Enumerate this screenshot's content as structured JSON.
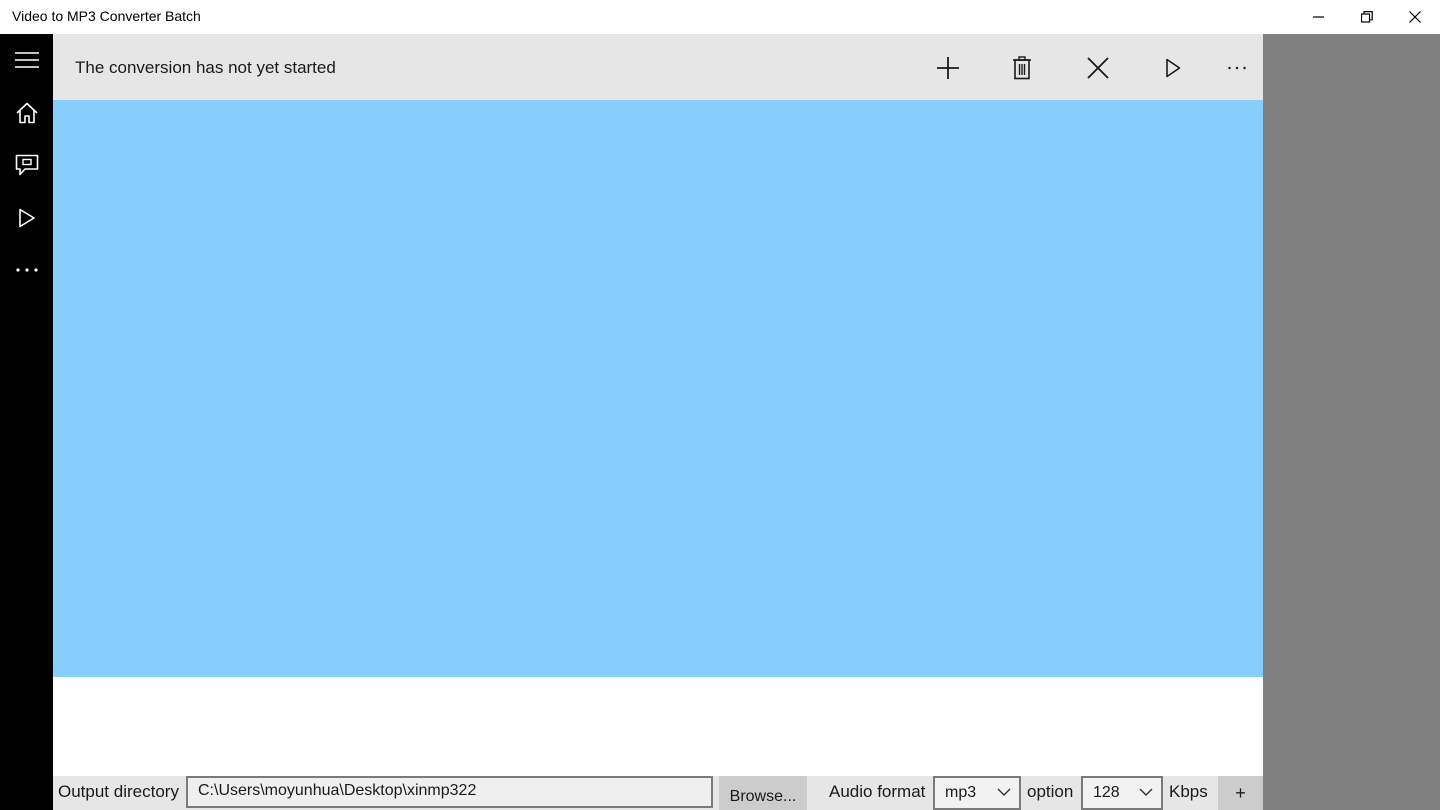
{
  "window": {
    "title": "Video to MP3 Converter Batch"
  },
  "navrail": {
    "items": [
      {
        "icon": "hamburger-menu-icon"
      },
      {
        "icon": "home-icon"
      },
      {
        "icon": "feedback-icon"
      },
      {
        "icon": "play-icon"
      },
      {
        "icon": "more-icon"
      }
    ]
  },
  "commandbar": {
    "status": "The conversion has not yet started",
    "buttons": [
      "add-icon",
      "delete-icon",
      "clear-icon",
      "play-icon",
      "more-icon"
    ]
  },
  "settings": {
    "output_directory_label": "Output directory",
    "output_directory_value": "C:\\Users\\moyunhua\\Desktop\\xinmp322",
    "browse_label": "Browse...",
    "audio_format_label": "Audio format",
    "audio_format_value": "mp3",
    "option_label": "option",
    "bitrate_value": "128",
    "bitrate_unit": "Kbps",
    "add_label": "+"
  },
  "colors": {
    "drop_area": "#87cefa",
    "nav_rail": "#000000",
    "command_bar": "#e6e6e6",
    "right_pane": "#808080"
  }
}
